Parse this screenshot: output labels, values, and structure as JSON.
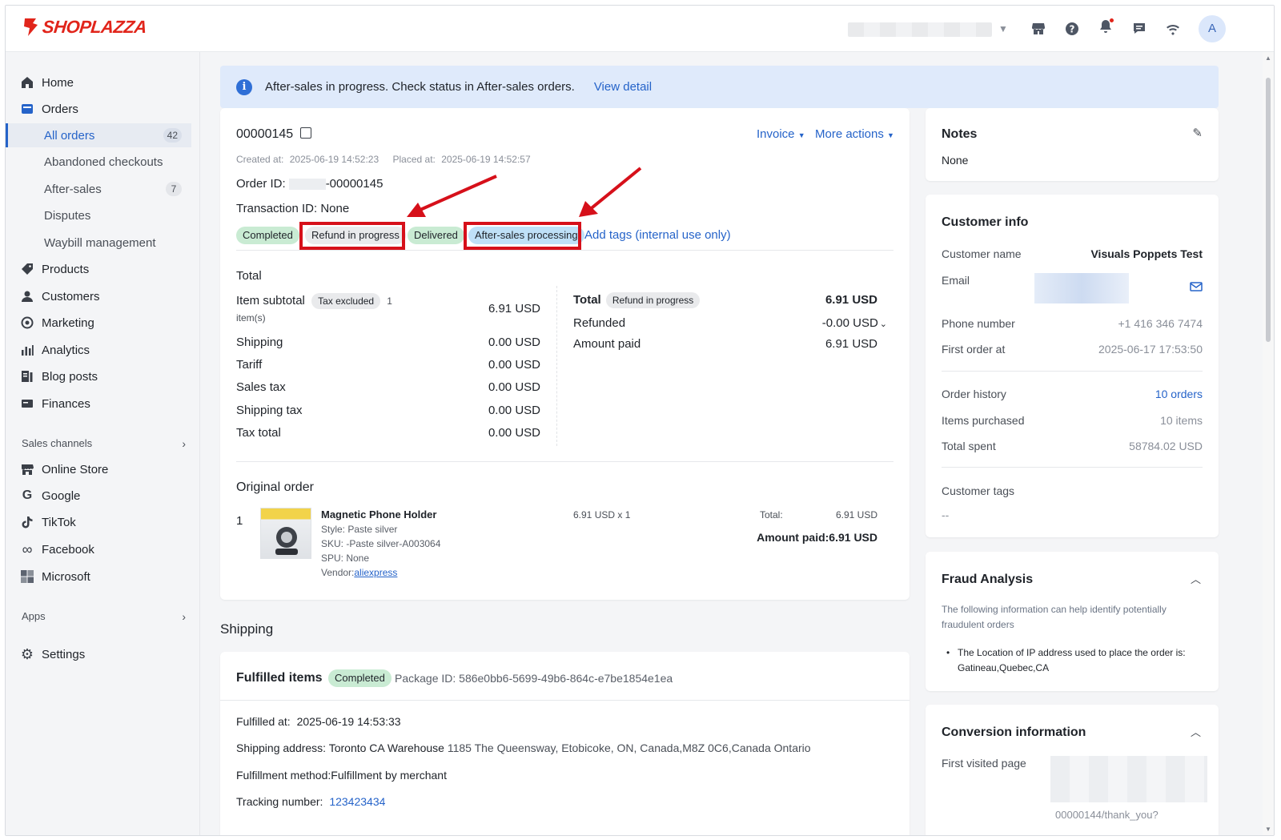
{
  "brand": {
    "logo_text": "SHOPLAZZA",
    "accent": "#e1251b",
    "link_color": "#2563c9"
  },
  "topbar": {
    "avatar_initial": "A"
  },
  "sidebar": {
    "home": "Home",
    "orders": "Orders",
    "orders_sub": [
      {
        "label": "All orders",
        "count": "42"
      },
      {
        "label": "Abandoned checkouts"
      },
      {
        "label": "After-sales",
        "count": "7"
      },
      {
        "label": "Disputes"
      },
      {
        "label": "Waybill management"
      }
    ],
    "products": "Products",
    "customers": "Customers",
    "marketing": "Marketing",
    "analytics": "Analytics",
    "blog_posts": "Blog posts",
    "finances": "Finances",
    "sales_channels_label": "Sales channels",
    "channels": [
      "Online Store",
      "Google",
      "TikTok",
      "Facebook",
      "Microsoft"
    ],
    "apps_label": "Apps",
    "settings": "Settings"
  },
  "banner": {
    "text": "After-sales in progress. Check status in After-sales orders.",
    "link": "View detail"
  },
  "order": {
    "number": "00000145",
    "invoice_label": "Invoice",
    "more_actions_label": "More actions",
    "created_label": "Created at:",
    "created_value": "2025-06-19 14:52:23",
    "placed_label": "Placed at:",
    "placed_value": "2025-06-19 14:52:57",
    "order_id_label": "Order ID:",
    "order_id_suffix": "-00000145",
    "transaction_label": "Transaction ID: None",
    "tags": [
      "Completed",
      "Refund in progress",
      "Delivered",
      "After-sales processing"
    ],
    "add_tags_label": "Add tags (internal use only)",
    "total_title": "Total",
    "item_subtotal_label": "Item subtotal",
    "tax_excluded_badge": "Tax excluded",
    "item_count": "1",
    "items_unit": "item(s)",
    "item_subtotal_value": "6.91 USD",
    "rows": [
      {
        "label": "Shipping",
        "value": "0.00 USD"
      },
      {
        "label": "Tariff",
        "value": "0.00 USD"
      },
      {
        "label": "Sales tax",
        "value": "0.00 USD"
      },
      {
        "label": "Shipping tax",
        "value": "0.00 USD"
      },
      {
        "label": "Tax total",
        "value": "0.00 USD"
      }
    ],
    "summary_total_label": "Total",
    "summary_total_badge": "Refund in progress",
    "summary_total_value": "6.91 USD",
    "refunded_label": "Refunded",
    "refunded_value": "-0.00 USD",
    "amount_paid_label": "Amount paid",
    "amount_paid_value": "6.91 USD",
    "original_order_title": "Original order",
    "line": {
      "index": "1",
      "name": "Magnetic Phone Holder",
      "style": "Style: Paste silver",
      "sku": "SKU: -Paste silver-A003064",
      "spu": "SPU: None",
      "vendor_label": "Vendor:",
      "vendor_link": "aliexpress",
      "price_qty": "6.91 USD x 1",
      "total_label": "Total:",
      "total_value": "6.91 USD",
      "amount_paid": "Amount paid:6.91 USD"
    }
  },
  "shipping": {
    "title": "Shipping",
    "fulfilled_title": "Fulfilled items",
    "status_tag": "Completed",
    "package_id": "Package ID: 586e0bb6-5699-49b6-864c-e7be1854e1ea",
    "fulfilled_at_label": "Fulfilled at:",
    "fulfilled_at_value": "2025-06-19 14:53:33",
    "address_label": "Shipping address:",
    "address_name": "Toronto CA Warehouse",
    "address_value": "1185 The Queensway, Etobicoke, ON, Canada,M8Z 0C6,Canada Ontario",
    "method": "Fulfillment method:Fulfillment by merchant",
    "tracking_label": "Tracking number:",
    "tracking_value": "123423434"
  },
  "notes": {
    "title": "Notes",
    "value": "None"
  },
  "customer": {
    "title": "Customer info",
    "name_label": "Customer name",
    "name_value": "Visuals Poppets Test",
    "email_label": "Email",
    "phone_label": "Phone number",
    "phone_value": "+1 416 346 7474",
    "first_order_label": "First order at",
    "first_order_value": "2025-06-17 17:53:50",
    "history_label": "Order history",
    "history_value": "10 orders",
    "items_label": "Items purchased",
    "items_value": "10 items",
    "spent_label": "Total spent",
    "spent_value": "58784.02 USD",
    "tags_label": "Customer tags",
    "tags_value": "--"
  },
  "fraud": {
    "title": "Fraud Analysis",
    "description": "The following information can help identify potentially fraudulent orders",
    "bullet": "The Location of IP address used to place the order is: Gatineau,Quebec,CA"
  },
  "conversion": {
    "title": "Conversion information",
    "first_visited_label": "First visited page",
    "url_fragment": "00000144/thank_you?"
  }
}
